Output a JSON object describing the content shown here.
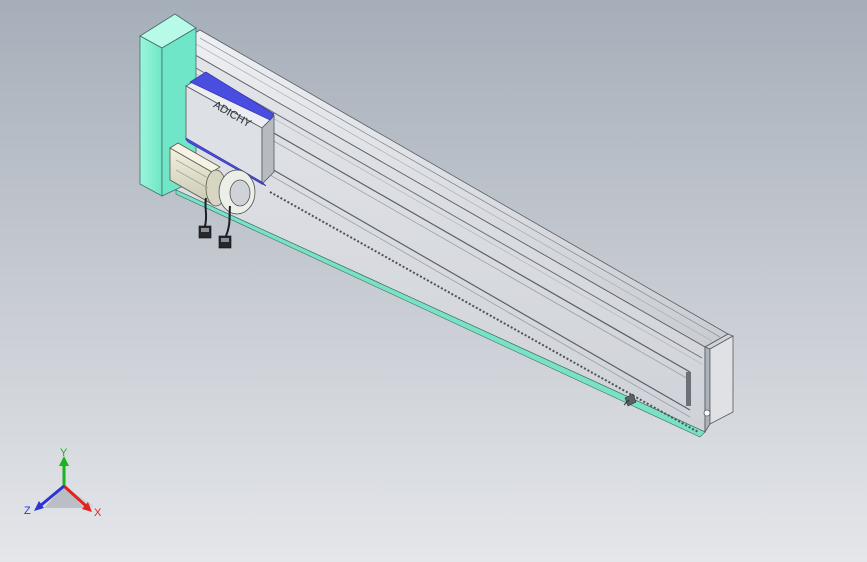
{
  "triad": {
    "x_label": "X",
    "y_label": "Y",
    "z_label": "Z",
    "x_color": "#e0241e",
    "y_color": "#19b31e",
    "z_color": "#2a35d6"
  },
  "carriage": {
    "logo_text": "ADICHY"
  },
  "colors": {
    "end_plate": "#7ff2d4",
    "rail_body": "#d9dbe0",
    "carriage_accent": "#4a4ee0",
    "motor_body": "#e6e5d2",
    "background_top": "#a6aeb9",
    "background_bottom": "#e4e6ea"
  },
  "icons": {
    "view_triad": "axis-triad-icon"
  }
}
